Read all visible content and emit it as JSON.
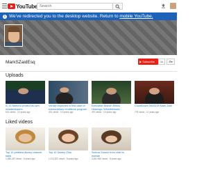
{
  "app": {
    "logo_text": "YouTube"
  },
  "search": {
    "placeholder": "Search"
  },
  "banner": {
    "text": "We've redirected you to the desktop website. Return to ",
    "link": "mobile YouTube."
  },
  "channel": {
    "name": "MarkSZaidEsq",
    "subscribe_label": "Subscribe",
    "subscriber_count": "1k",
    "settings_label": "⚙▾"
  },
  "uploads": {
    "title": "Uploads",
    "videos": [
      {
        "title": "IC IG failed to protect its own whistleblowers",
        "meta": "614 views · 10 years ago",
        "duration": ""
      },
      {
        "title": "Verdict expected in first case of extraordinary renditions program",
        "meta": "431 views · 10 years ago",
        "duration": ""
      },
      {
        "title": "Executive Branch Ethics Hearings: Whistleblower Protections",
        "meta": "497 views · 10 years ago",
        "duration": ""
      },
      {
        "title": "CountDown 06/03/29 Mark Zaid",
        "meta": "778 views · 11 years ago",
        "duration": ""
      }
    ]
  },
  "liked": {
    "title": "Liked videos",
    "videos": [
      {
        "title": "Top 10 prettiest disney channel stars",
        "meta": "1,086,287 views · 6 years ago",
        "duration": ""
      },
      {
        "title": "Top 10 Disney Girls",
        "meta": "1,013,837 views · 8 years ago",
        "duration": ""
      },
      {
        "title": "Selena Gomez from child to woman",
        "meta": "3,062,562 views · 8 years ago",
        "duration": ""
      }
    ]
  },
  "colors": {
    "brand": "#e62117",
    "banner": "#1c62b9",
    "link": "#167ac6"
  }
}
